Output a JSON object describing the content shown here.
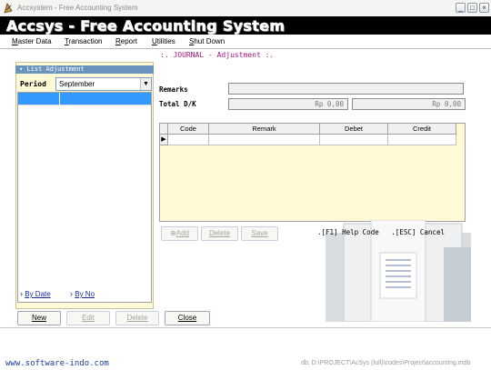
{
  "window": {
    "title": "Accsystem - Free Accounting System",
    "min_symbol": "_",
    "max_symbol": "□",
    "close_symbol": "×"
  },
  "banner": {
    "title": "Accsys - Free Accounting System"
  },
  "menu": {
    "items": [
      {
        "hot": "M",
        "rest": "aster Data"
      },
      {
        "hot": "T",
        "rest": "ransaction"
      },
      {
        "hot": "R",
        "rest": "eport"
      },
      {
        "hot": "U",
        "rest": "tilities"
      },
      {
        "hot": "S",
        "rest": "hut Down"
      }
    ]
  },
  "left_panel": {
    "header": "List Adjustment",
    "period_label": "Period",
    "period_value": "September",
    "by_date": "By Date",
    "by_no": "By No"
  },
  "journal": {
    "title": ":. JOURNAL - Adjustment :.",
    "remarks_label": "Remarks",
    "total_label": "Total D/K",
    "total_debit": "Rp 0,00",
    "total_credit": "Rp 0,00"
  },
  "grid": {
    "columns": [
      "Code",
      "Remark",
      "Debet",
      "Credit"
    ],
    "row_marker": "▶"
  },
  "actions": {
    "add": "Add",
    "delete": "Delete",
    "save": "Save",
    "help": ".[F1] Help Code",
    "cancel": ".[ESC] Cancel"
  },
  "bottom_buttons": {
    "new": "New",
    "edit": "Edit",
    "delete": "Delete",
    "close": "Close"
  },
  "footer": {
    "website": "www.software-indo.com",
    "db_path": "db: D:\\PROJECT\\AcSys (full)\\codes\\Project\\accounting.mdb"
  }
}
